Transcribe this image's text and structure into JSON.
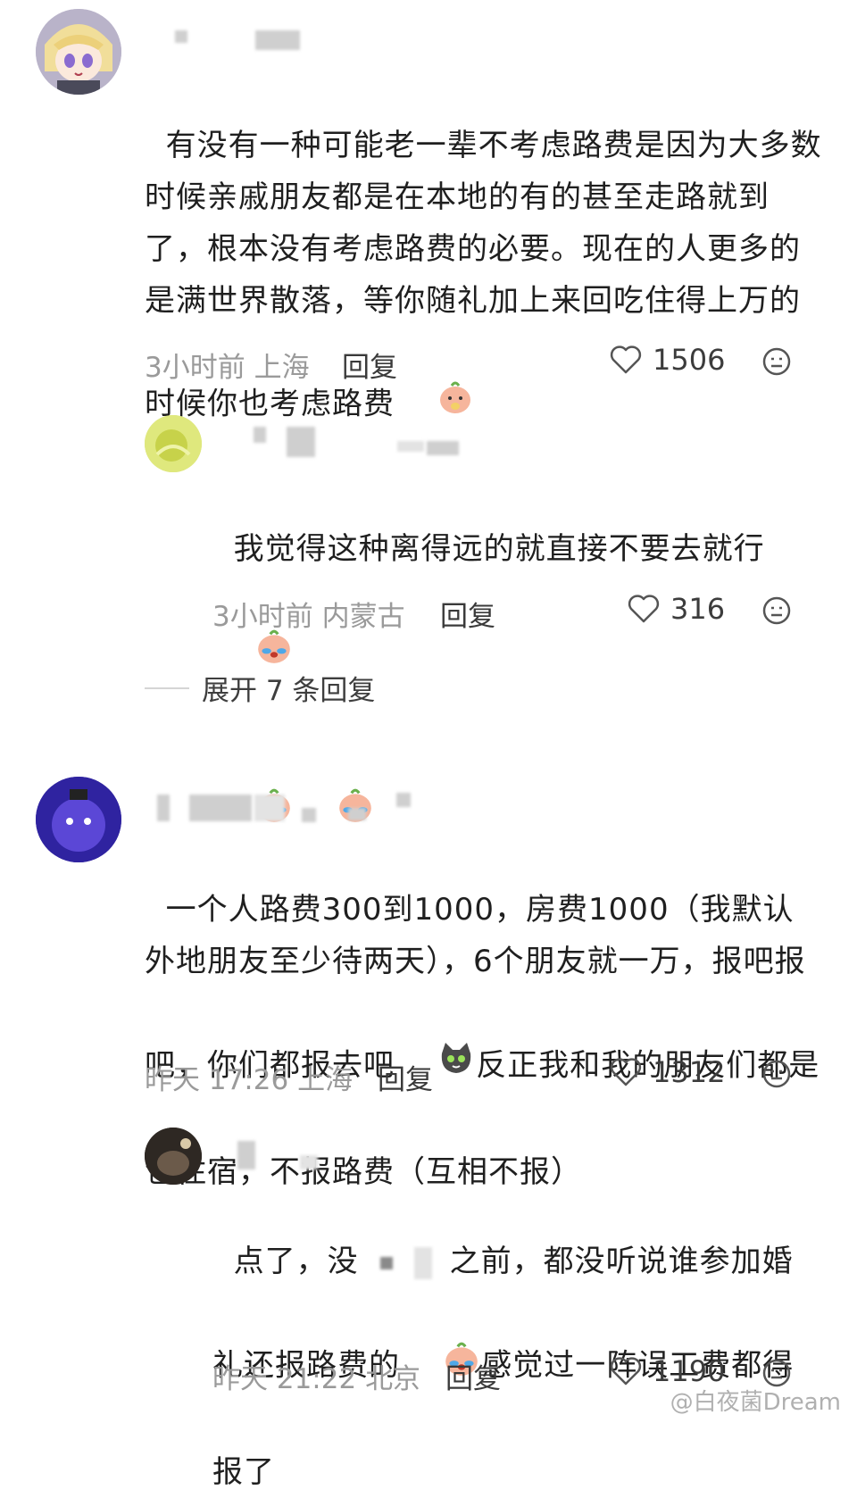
{
  "comments": [
    {
      "text": "有没有一种可能老一辈不考虑路费是因为大多数时候亲戚朋友都是在本地的有的甚至走路就到了，根本没有考虑路费的必要。现在的人更多的是满世界散落，等你随礼加上来回吃住得上万的时候你也考虑路费",
      "time": "3小时前",
      "location": "上海",
      "reply_label": "回复",
      "likes": "1506",
      "replies": [
        {
          "text": "我觉得这种离得远的就直接不要去就行",
          "time": "3小时前",
          "location": "内蒙古",
          "reply_label": "回复",
          "likes": "316"
        }
      ],
      "expand_label": "展开 7 条回复"
    },
    {
      "text_part1": "一个人路费300到1000，房费1000（我默认外地朋友至少待两天），6个朋友就一万，报吧报吧，你们都报去吧",
      "text_part2": "反正我和我的朋友们都是包住宿，不报路费（互相不报）",
      "time": "昨天 17:26",
      "location": "上海",
      "reply_label": "回复",
      "likes": "1312",
      "replies": [
        {
          "text_part1": "点了，没",
          "text_part2": "之前，都没听说谁参加婚礼还报路费的",
          "text_part3": "感觉过一阵误工费都得报了",
          "time": "昨天 21:22",
          "location": "北京",
          "reply_label": "回复",
          "likes": "1190"
        }
      ]
    }
  ],
  "watermark": "@白夜菌Dream",
  "icons": {
    "like": "heart-outline-icon",
    "more": "emoji-face-icon",
    "emoji": "peach-face-emoji",
    "cat": "cat-emoji"
  },
  "colors": {
    "text": "#1f1f1f",
    "meta": "#9a9a9a",
    "icon": "#555555"
  }
}
